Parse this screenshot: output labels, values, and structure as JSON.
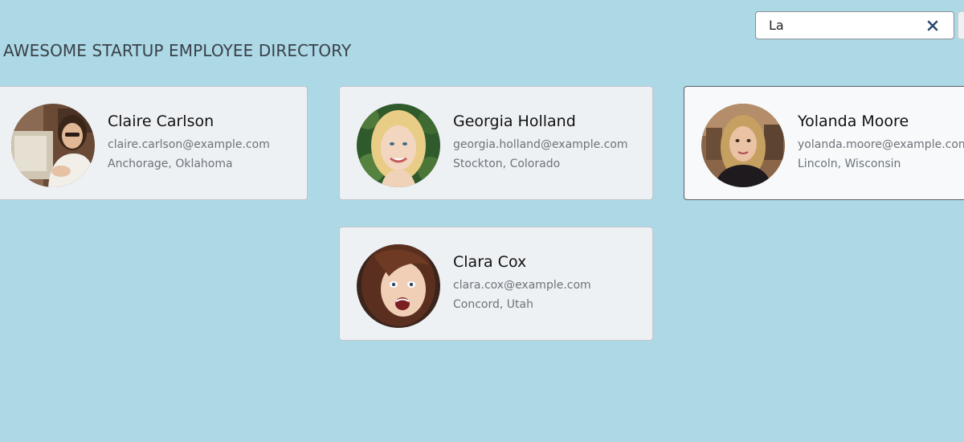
{
  "header": {
    "title": "AWESOME STARTUP EMPLOYEE DIRECTORY"
  },
  "search": {
    "value": "La",
    "clear_icon": "close-icon"
  },
  "employees": [
    {
      "name": "Claire Carlson",
      "email": "claire.carlson@example.com",
      "location": "Anchorage, Oklahoma"
    },
    {
      "name": "Georgia Holland",
      "email": "georgia.holland@example.com",
      "location": "Stockton, Colorado"
    },
    {
      "name": "Yolanda Moore",
      "email": "yolanda.moore@example.com",
      "location": "Lincoln, Wisconsin"
    },
    {
      "name": "Clara Cox",
      "email": "clara.cox@example.com",
      "location": "Concord, Utah"
    }
  ],
  "colors": {
    "background": "#add8e6",
    "card": "#eef1f4",
    "accent_icon": "#2b4a70"
  }
}
